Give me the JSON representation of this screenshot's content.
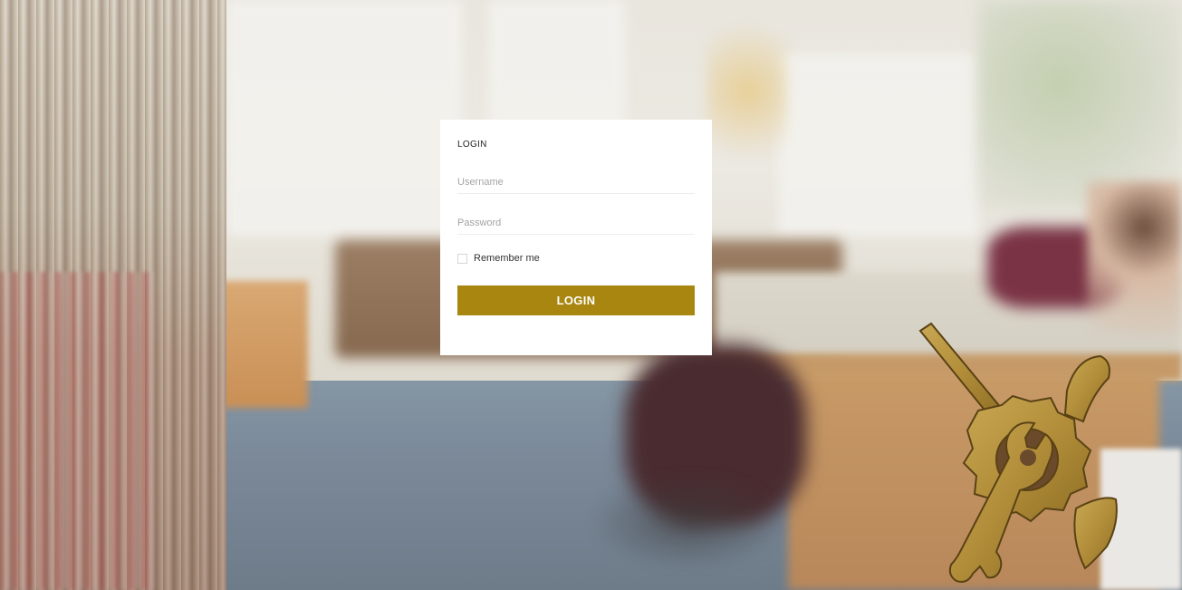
{
  "login_card": {
    "title": "LOGIN",
    "username_placeholder": "Username",
    "password_placeholder": "Password",
    "remember_label": "Remember me",
    "remember_checked": false,
    "submit_label": "LOGIN"
  },
  "colors": {
    "accent": "#a8860f",
    "card_background": "#ffffff",
    "emblem_gold": "#b8963c"
  },
  "icons": {
    "emblem": "gear-wrench-hammer-logo-icon"
  }
}
